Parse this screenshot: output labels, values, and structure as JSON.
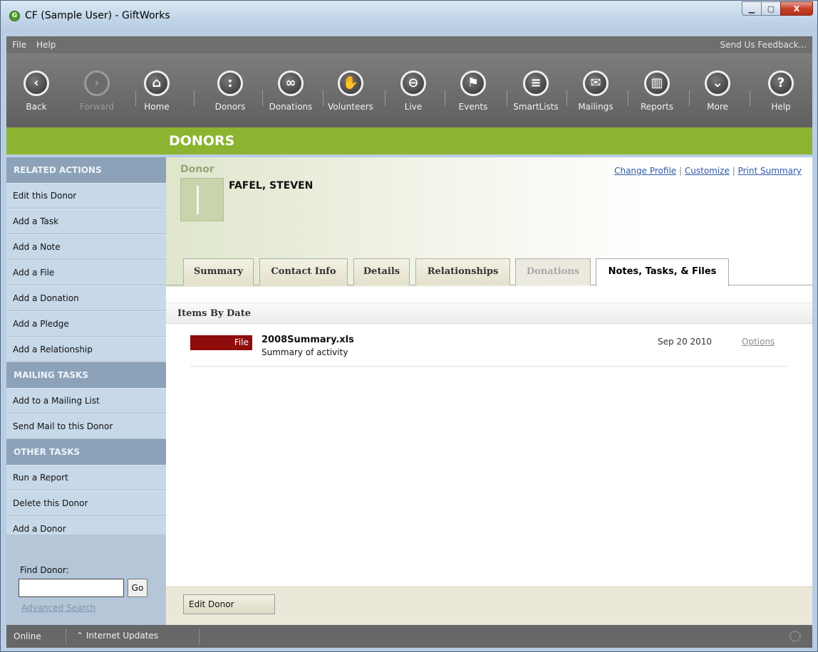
{
  "window": {
    "title": "CF (Sample User) - GiftWorks",
    "minimize": "▁",
    "maximize": "▢",
    "close": "X"
  },
  "menu": {
    "file": "File",
    "help": "Help",
    "feedback": "Send Us Feedback..."
  },
  "toolbar": {
    "back": "Back",
    "forward": "Forward",
    "home": "Home",
    "donors": "Donors",
    "donations": "Donations",
    "volunteers": "Volunteers",
    "live": "Live",
    "events": "Events",
    "smartlists": "SmartLists",
    "mailings": "Mailings",
    "reports": "Reports",
    "more": "More",
    "help": "Help"
  },
  "section": {
    "title": "DONORS"
  },
  "sidebar": {
    "related_header": "RELATED ACTIONS",
    "related": [
      "Edit this Donor",
      "Add a Task",
      "Add a Note",
      "Add a File",
      "Add a Donation",
      "Add a Pledge",
      "Add a Relationship"
    ],
    "mailing_header": "MAILING TASKS",
    "mailing": [
      "Add to a Mailing List",
      "Send Mail to this Donor"
    ],
    "other_header": "OTHER TASKS",
    "other": [
      "Run a Report",
      "Delete this Donor",
      "Add a Donor"
    ],
    "find_label": "Find Donor:",
    "find_value": "",
    "go": "Go",
    "advanced": "Advanced Search"
  },
  "donor": {
    "kind": "Donor",
    "name": "FAFEL, STEVEN",
    "links": {
      "change_profile": "Change Profile",
      "customize": "Customize",
      "print_summary": "Print Summary",
      "separator": "|"
    }
  },
  "tabs": {
    "summary": "Summary",
    "contact": "Contact Info",
    "details": "Details",
    "relationships": "Relationships",
    "donations": "Donations",
    "notes": "Notes, Tasks, & Files"
  },
  "items": {
    "header": "Items By Date",
    "rows": [
      {
        "type": "File",
        "name": "2008Summary.xls",
        "description": "Summary of activity",
        "date": "Sep 20 2010",
        "options": "Options"
      }
    ]
  },
  "bottom": {
    "edit_button": "Edit Donor"
  },
  "status": {
    "online": "Online",
    "updates": "Internet Updates",
    "updates_icon": "⌃"
  },
  "colors": {
    "section_green": "#8db431",
    "file_badge": "#8e0c0c",
    "sidebar_header": "#8ba2b9",
    "toolbar_gray": "#6e6e6e"
  }
}
